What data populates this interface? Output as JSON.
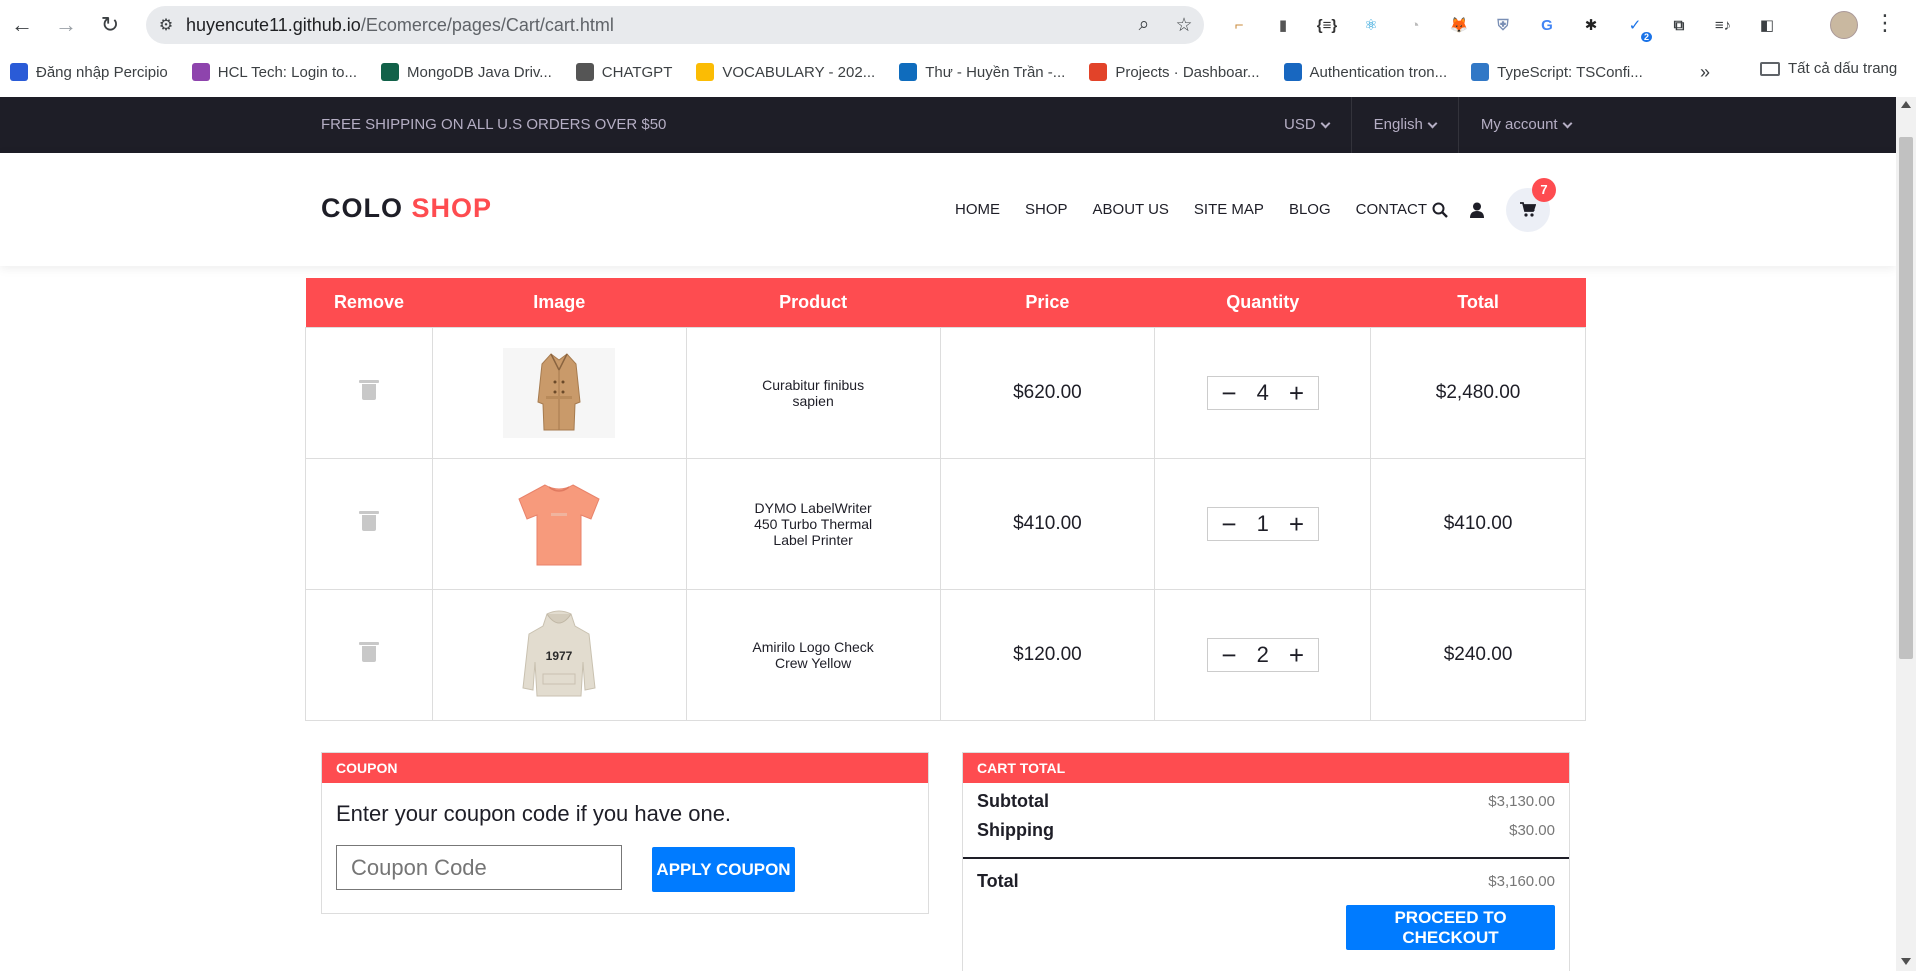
{
  "browser": {
    "url_host": "huyencute11.github.io",
    "url_path": "/Ecomerce/pages/Cart/cart.html",
    "bookmarks": [
      {
        "label": "Đăng nhập Percipio",
        "icon": "percipio-icon",
        "color": "#2a5bd7"
      },
      {
        "label": "HCL Tech: Login to...",
        "icon": "hcl-icon",
        "color": "#8e44ad"
      },
      {
        "label": "MongoDB Java Driv...",
        "icon": "mongodb-icon",
        "color": "#116149"
      },
      {
        "label": "CHATGPT",
        "icon": "chatgpt-icon",
        "color": "#555555"
      },
      {
        "label": "VOCABULARY - 202...",
        "icon": "google-drive-icon",
        "color": "#fbbc04"
      },
      {
        "label": "Thư - Huyền Trần -...",
        "icon": "outlook-icon",
        "color": "#0f6cbd"
      },
      {
        "label": "Projects · Dashboar...",
        "icon": "gitlab-icon",
        "color": "#e24329"
      },
      {
        "label": "Authentication tron...",
        "icon": "vuetify-icon",
        "color": "#1867c0"
      },
      {
        "label": "TypeScript: TSConfi...",
        "icon": "typescript-icon",
        "color": "#3178c6"
      }
    ],
    "bookmarks_folder": "Tất cả dấu trang",
    "extensions": [
      {
        "glyph": "⌐",
        "color": "#c98a3a"
      },
      {
        "glyph": "▮",
        "color": "#555555"
      },
      {
        "glyph": "{≡}",
        "color": "#333333"
      },
      {
        "glyph": "⚛",
        "color": "#1a9bd7"
      },
      {
        "glyph": "◔",
        "color": "#bbbbbb"
      },
      {
        "glyph": "🦊",
        "color": "#e2761b"
      },
      {
        "glyph": "⛨",
        "color": "#7a8fb5"
      },
      {
        "glyph": "G",
        "color": "#4285f4"
      },
      {
        "glyph": "✱",
        "color": "#222222"
      },
      {
        "glyph": "✓",
        "color": "#1a73e8",
        "badge": "2"
      },
      {
        "glyph": "⧉",
        "color": "#3c4043"
      },
      {
        "glyph": "≡♪",
        "color": "#3c4043"
      },
      {
        "glyph": "◧",
        "color": "#3c4043"
      }
    ]
  },
  "topbar": {
    "free_shipping": "FREE SHIPPING ON ALL U.S ORDERS OVER $50",
    "currency": "USD",
    "language": "English",
    "account": "My account"
  },
  "nav": {
    "logo_main": "COLO",
    "logo_accent": "SHOP",
    "links": [
      "HOME",
      "SHOP",
      "ABOUT US",
      "SITE MAP",
      "BLOG",
      "CONTACT"
    ],
    "cart_count": "7"
  },
  "cart": {
    "headers": {
      "remove": "Remove",
      "image": "Image",
      "product": "Product",
      "price": "Price",
      "quantity": "Quantity",
      "total": "Total"
    },
    "items": [
      {
        "name": "Curabitur finibus sapien",
        "price": "$620.00",
        "qty": "4",
        "total": "$2,480.00",
        "image": "coat-image"
      },
      {
        "name": "DYMO LabelWriter 450 Turbo Thermal Label Printer",
        "price": "$410.00",
        "qty": "1",
        "total": "$410.00",
        "image": "tshirt-image"
      },
      {
        "name": "Amirilo Logo Check Crew Yellow",
        "price": "$120.00",
        "qty": "2",
        "total": "$240.00",
        "image": "hoodie-image"
      }
    ]
  },
  "coupon": {
    "title": "COUPON",
    "text": "Enter your coupon code if you have one.",
    "placeholder": "Coupon Code",
    "button": "APPLY COUPON"
  },
  "cart_total": {
    "title": "CART TOTAL",
    "subtotal_label": "Subtotal",
    "subtotal": "$3,130.00",
    "shipping_label": "Shipping",
    "shipping": "$30.00",
    "total_label": "Total",
    "total": "$3,160.00",
    "checkout": "PROCEED TO CHECKOUT"
  },
  "hoodie_print": "1977",
  "colors": {
    "accent": "#fe4c50",
    "topbar": "#1e1e27",
    "button": "#007bff"
  }
}
